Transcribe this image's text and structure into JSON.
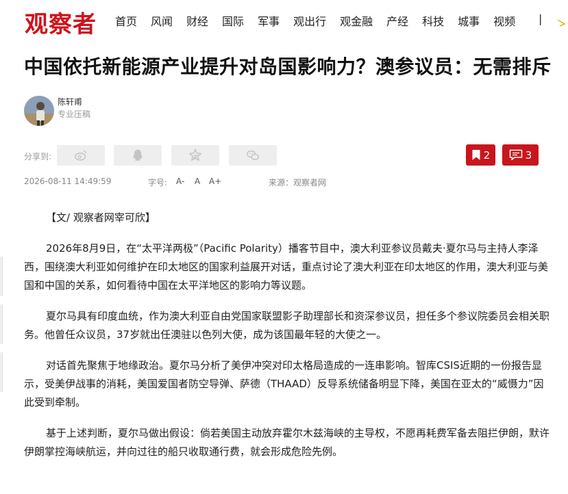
{
  "logo": "观察者",
  "nav": [
    "首页",
    "风闻",
    "财经",
    "国际",
    "军事",
    "观出行",
    "观金融",
    "产经",
    "科技",
    "城事",
    "视频"
  ],
  "nav_separator": "|",
  "headline": "中国依托新能源产业提升对岛国影响力？澳参议员：无需排斥",
  "author": {
    "name": "陈轩甫",
    "title": "专业压稿"
  },
  "share": {
    "label": "分享到:",
    "icons": [
      "weibo-icon",
      "qq-icon",
      "qzone-star-icon",
      "wechat-icon"
    ]
  },
  "counts": {
    "bookmark": "2",
    "comments": "3"
  },
  "meta": {
    "datetime": "2026-08-11 14:49:59",
    "font_size_label": "字号:",
    "font_sizes": [
      "A-",
      "A",
      "A+"
    ],
    "source": "来源：观察者网"
  },
  "article": {
    "byline": "【文/ 观察者网宰可欣】",
    "paragraphs": [
      "2026年8月9日，在“太平洋两极”（Pacific Polarity）播客节目中，澳大利亚参议员戴夫·夏尔马与主持人李泽西，围绕澳大利亚如何维护在印太地区的国家利益展开对话，重点讨论了澳大利亚在印太地区的作用，澳大利亚与美国和中国的关系，如何看待中国在太平洋地区的影响力等议题。",
      "夏尔马具有印度血统，作为澳大利亚自由党国家联盟影子助理部长和资深参议员，担任多个参议院委员会相关职务。他曾任众议员，37岁就出任澳驻以色列大使，成为该国最年轻的大使之一。",
      "对话首先聚焦于地缘政治。夏尔马分析了美伊冲突对印太格局造成的一连串影响。智库CSIS近期的一份报告显示，受美伊战事的消耗，美国爱国者防空导弹、萨德（THAAD）反导系统储备明显下降，美国在亚太的“威慑力”因此受到牵制。",
      "基于上述判断，夏尔马做出假设：倘若美国主动放弃霍尔木兹海峡的主导权，不愿再耗费军备去阻拦伊朗，默许伊朗掌控海峡航运，并向过往的船只收取通行费，就会形成危险先例。"
    ]
  },
  "colors": {
    "brand": "#d0121b",
    "count_button": "#c9161d",
    "share_button_bg": "#eeeeee"
  }
}
